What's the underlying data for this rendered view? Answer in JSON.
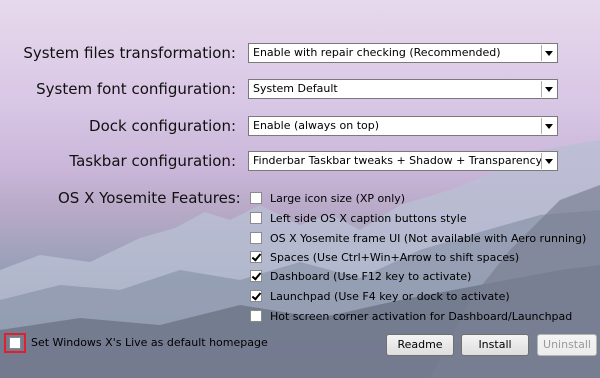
{
  "settings": [
    {
      "label": "System files transformation:",
      "value": "Enable with repair checking (Recommended)"
    },
    {
      "label": "System font configuration:",
      "value": "System Default"
    },
    {
      "label": "Dock configuration:",
      "value": "Enable (always on top)"
    },
    {
      "label": "Taskbar configuration:",
      "value": "Finderbar Taskbar tweaks + Shadow + Transparency"
    }
  ],
  "features": {
    "title": "OS X Yosemite Features:",
    "items": [
      {
        "label": "Large icon size (XP only)",
        "checked": false
      },
      {
        "label": "Left side OS X caption buttons style",
        "checked": false
      },
      {
        "label": "OS X Yosemite frame UI (Not available with Aero running)",
        "checked": false
      },
      {
        "label": "Spaces (Use Ctrl+Win+Arrow to shift spaces)",
        "checked": true
      },
      {
        "label": "Dashboard (Use F12 key to activate)",
        "checked": true
      },
      {
        "label": "Launchpad (Use F4 key or dock to activate)",
        "checked": true
      },
      {
        "label": "Hot screen corner activation for Dashboard/Launchpad",
        "checked": false
      }
    ]
  },
  "homepage": {
    "label": "Set Windows X's Live as default homepage",
    "checked": false
  },
  "buttons": {
    "readme": "Readme",
    "install": "Install",
    "uninstall": "Uninstall"
  },
  "colors": {
    "highlight_border": "#e0202a"
  }
}
